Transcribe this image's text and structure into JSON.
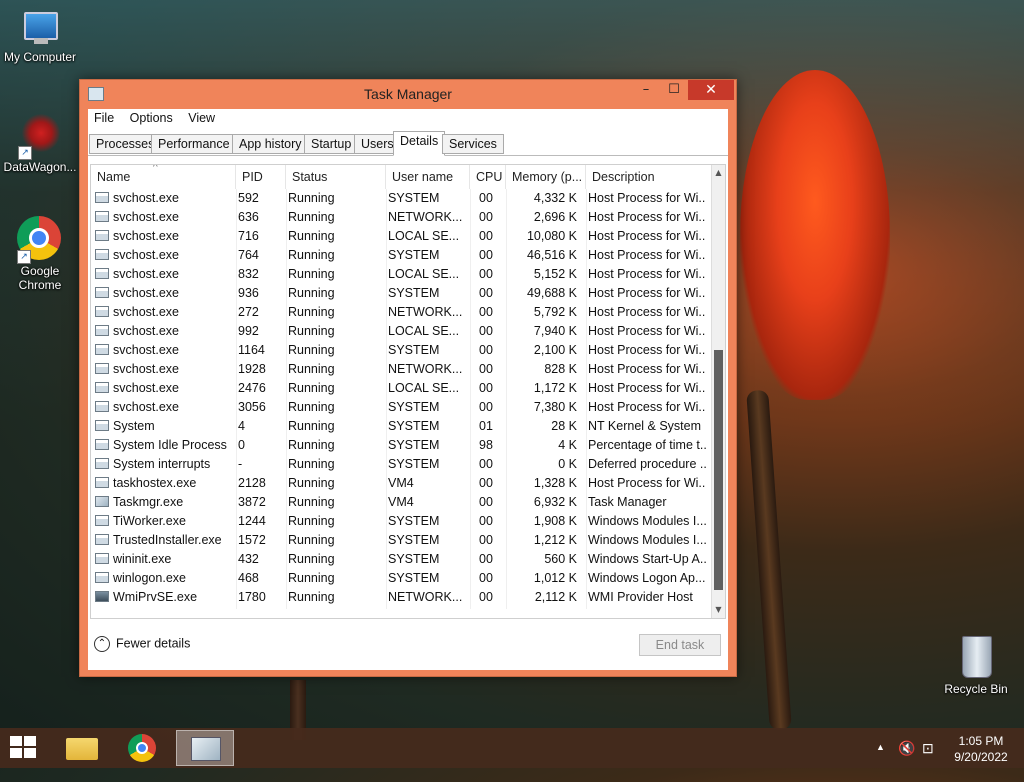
{
  "desktop": {
    "icons": [
      {
        "label": "My Computer"
      },
      {
        "label": "DataWagon..."
      },
      {
        "label": "Google Chrome"
      },
      {
        "label": "Recycle Bin"
      }
    ]
  },
  "window": {
    "title": "Task Manager",
    "controls": {
      "minimize": "–",
      "maximize": "☐",
      "close": "✕"
    },
    "menu": [
      "File",
      "Options",
      "View"
    ],
    "tabs": [
      "Processes",
      "Performance",
      "App history",
      "Startup",
      "Users",
      "Details",
      "Services"
    ],
    "active_tab": "Details",
    "columns": [
      "Name",
      "PID",
      "Status",
      "User name",
      "CPU",
      "Memory (p...",
      "Description"
    ],
    "sorted_column": "Name",
    "rows": [
      {
        "icon": "svchost-icon",
        "name": "svchost.exe",
        "pid": "592",
        "status": "Running",
        "user": "SYSTEM",
        "cpu": "00",
        "mem": "4,332 K",
        "desc": "Host Process for Wi..."
      },
      {
        "icon": "svchost-icon",
        "name": "svchost.exe",
        "pid": "636",
        "status": "Running",
        "user": "NETWORK...",
        "cpu": "00",
        "mem": "2,696 K",
        "desc": "Host Process for Wi..."
      },
      {
        "icon": "svchost-icon",
        "name": "svchost.exe",
        "pid": "716",
        "status": "Running",
        "user": "LOCAL SE...",
        "cpu": "00",
        "mem": "10,080 K",
        "desc": "Host Process for Wi..."
      },
      {
        "icon": "svchost-icon",
        "name": "svchost.exe",
        "pid": "764",
        "status": "Running",
        "user": "SYSTEM",
        "cpu": "00",
        "mem": "46,516 K",
        "desc": "Host Process for Wi..."
      },
      {
        "icon": "svchost-icon",
        "name": "svchost.exe",
        "pid": "832",
        "status": "Running",
        "user": "LOCAL SE...",
        "cpu": "00",
        "mem": "5,152 K",
        "desc": "Host Process for Wi..."
      },
      {
        "icon": "svchost-icon",
        "name": "svchost.exe",
        "pid": "936",
        "status": "Running",
        "user": "SYSTEM",
        "cpu": "00",
        "mem": "49,688 K",
        "desc": "Host Process for Wi..."
      },
      {
        "icon": "svchost-icon",
        "name": "svchost.exe",
        "pid": "272",
        "status": "Running",
        "user": "NETWORK...",
        "cpu": "00",
        "mem": "5,792 K",
        "desc": "Host Process for Wi..."
      },
      {
        "icon": "svchost-icon",
        "name": "svchost.exe",
        "pid": "992",
        "status": "Running",
        "user": "LOCAL SE...",
        "cpu": "00",
        "mem": "7,940 K",
        "desc": "Host Process for Wi..."
      },
      {
        "icon": "svchost-icon",
        "name": "svchost.exe",
        "pid": "1164",
        "status": "Running",
        "user": "SYSTEM",
        "cpu": "00",
        "mem": "2,100 K",
        "desc": "Host Process for Wi..."
      },
      {
        "icon": "svchost-icon",
        "name": "svchost.exe",
        "pid": "1928",
        "status": "Running",
        "user": "NETWORK...",
        "cpu": "00",
        "mem": "828 K",
        "desc": "Host Process for Wi..."
      },
      {
        "icon": "svchost-icon",
        "name": "svchost.exe",
        "pid": "2476",
        "status": "Running",
        "user": "LOCAL SE...",
        "cpu": "00",
        "mem": "1,172 K",
        "desc": "Host Process for Wi..."
      },
      {
        "icon": "svchost-icon",
        "name": "svchost.exe",
        "pid": "3056",
        "status": "Running",
        "user": "SYSTEM",
        "cpu": "00",
        "mem": "7,380 K",
        "desc": "Host Process for Wi..."
      },
      {
        "icon": "process-icon",
        "name": "System",
        "pid": "4",
        "status": "Running",
        "user": "SYSTEM",
        "cpu": "01",
        "mem": "28 K",
        "desc": "NT Kernel & System"
      },
      {
        "icon": "process-icon",
        "name": "System Idle Process",
        "pid": "0",
        "status": "Running",
        "user": "SYSTEM",
        "cpu": "98",
        "mem": "4 K",
        "desc": "Percentage of time t..."
      },
      {
        "icon": "process-icon",
        "name": "System interrupts",
        "pid": "-",
        "status": "Running",
        "user": "SYSTEM",
        "cpu": "00",
        "mem": "0 K",
        "desc": "Deferred procedure ..."
      },
      {
        "icon": "process-icon",
        "name": "taskhostex.exe",
        "pid": "2128",
        "status": "Running",
        "user": "VM4",
        "cpu": "00",
        "mem": "1,328 K",
        "desc": "Host Process for Wi..."
      },
      {
        "icon": "taskmgr-icon",
        "name": "Taskmgr.exe",
        "pid": "3872",
        "status": "Running",
        "user": "VM4",
        "cpu": "00",
        "mem": "6,932 K",
        "desc": "Task Manager"
      },
      {
        "icon": "process-icon",
        "name": "TiWorker.exe",
        "pid": "1244",
        "status": "Running",
        "user": "SYSTEM",
        "cpu": "00",
        "mem": "1,908 K",
        "desc": "Windows Modules I..."
      },
      {
        "icon": "process-icon",
        "name": "TrustedInstaller.exe",
        "pid": "1572",
        "status": "Running",
        "user": "SYSTEM",
        "cpu": "00",
        "mem": "1,212 K",
        "desc": "Windows Modules I..."
      },
      {
        "icon": "process-icon",
        "name": "wininit.exe",
        "pid": "432",
        "status": "Running",
        "user": "SYSTEM",
        "cpu": "00",
        "mem": "560 K",
        "desc": "Windows Start-Up A..."
      },
      {
        "icon": "process-icon",
        "name": "winlogon.exe",
        "pid": "468",
        "status": "Running",
        "user": "SYSTEM",
        "cpu": "00",
        "mem": "1,012 K",
        "desc": "Windows Logon Ap..."
      },
      {
        "icon": "wmi-icon",
        "name": "WmiPrvSE.exe",
        "pid": "1780",
        "status": "Running",
        "user": "NETWORK...",
        "cpu": "00",
        "mem": "2,112 K",
        "desc": "WMI Provider Host"
      }
    ],
    "footer": {
      "fewer_details": "Fewer details",
      "end_task": "End task"
    }
  },
  "taskbar": {
    "items": [
      "start-button",
      "file-explorer",
      "google-chrome",
      "task-manager"
    ],
    "active_item": "task-manager",
    "clock_time": "1:05 PM",
    "clock_date": "9/20/2022",
    "tray_icons": [
      "show-hidden-icons",
      "volume-muted-icon",
      "network-icon"
    ]
  },
  "colors": {
    "window_frame": "#f0845a",
    "close_button": "#c7392a",
    "scroll_thumb": "#606060"
  }
}
